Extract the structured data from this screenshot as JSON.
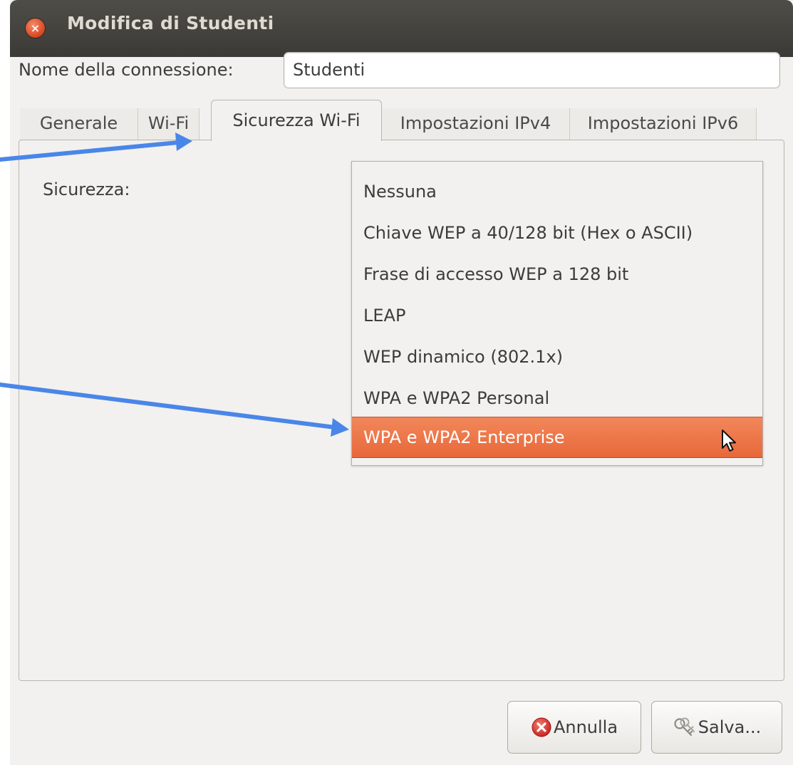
{
  "window": {
    "title": "Modifica di Studenti",
    "close_glyph": "×"
  },
  "connection": {
    "name_label": "Nome della connessione:",
    "name_value": "Studenti"
  },
  "tabs": [
    {
      "label": "Generale",
      "active": false
    },
    {
      "label": "Wi-Fi",
      "active": false
    },
    {
      "label": "Sicurezza Wi-Fi",
      "active": true
    },
    {
      "label": "Impostazioni IPv4",
      "active": false
    },
    {
      "label": "Impostazioni IPv6",
      "active": false
    }
  ],
  "security": {
    "label": "Sicurezza:",
    "options": [
      "Nessuna",
      "Chiave WEP a 40/128 bit (Hex o ASCII)",
      "Frase di accesso WEP a 128 bit",
      "LEAP",
      "WEP dinamico (802.1x)",
      "WPA e WPA2 Personal",
      "WPA e WPA2 Enterprise"
    ],
    "selected_index": 6
  },
  "buttons": {
    "cancel_label": "Annulla",
    "save_label": "Salva...",
    "cancel_icon": "close-circle-icon",
    "save_icon": "keys-icon"
  },
  "colors": {
    "accent": "#e9703f",
    "titlebar": "#3f3e3a",
    "annotation_arrow": "#4a86e8"
  }
}
